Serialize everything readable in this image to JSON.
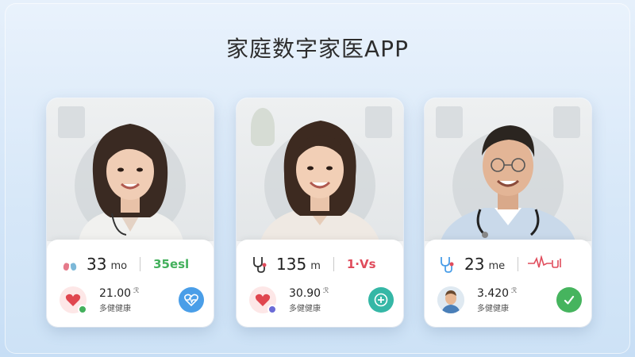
{
  "page": {
    "title": "家庭数字家医APP"
  },
  "cards": [
    {
      "stat_value": "33",
      "stat_unit": "mo",
      "side_value": "35esl",
      "metric_value": "21.00",
      "metric_unit": "ℛ",
      "metric_label": "多健健康",
      "action_icon": "heart-pulse-icon",
      "colors": {
        "action": "#4a9ee8",
        "side": "#43b05c",
        "badge": "#43b05c"
      }
    },
    {
      "stat_value": "135",
      "stat_unit": "m",
      "side_value": "1·Vs",
      "metric_value": "30.90",
      "metric_unit": "ℛ",
      "metric_label": "多健健康",
      "action_icon": "plus-icon",
      "colors": {
        "action": "#35b7a6",
        "side": "#e04c5c",
        "badge": "#6b6bd6"
      }
    },
    {
      "stat_value": "23",
      "stat_unit": "me",
      "side_value": "",
      "metric_value": "3.420",
      "metric_unit": "ℛ",
      "metric_label": "多健健康",
      "action_icon": "checkmark-icon",
      "colors": {
        "action": "#46b45e",
        "side": "#e04c5c"
      }
    }
  ]
}
